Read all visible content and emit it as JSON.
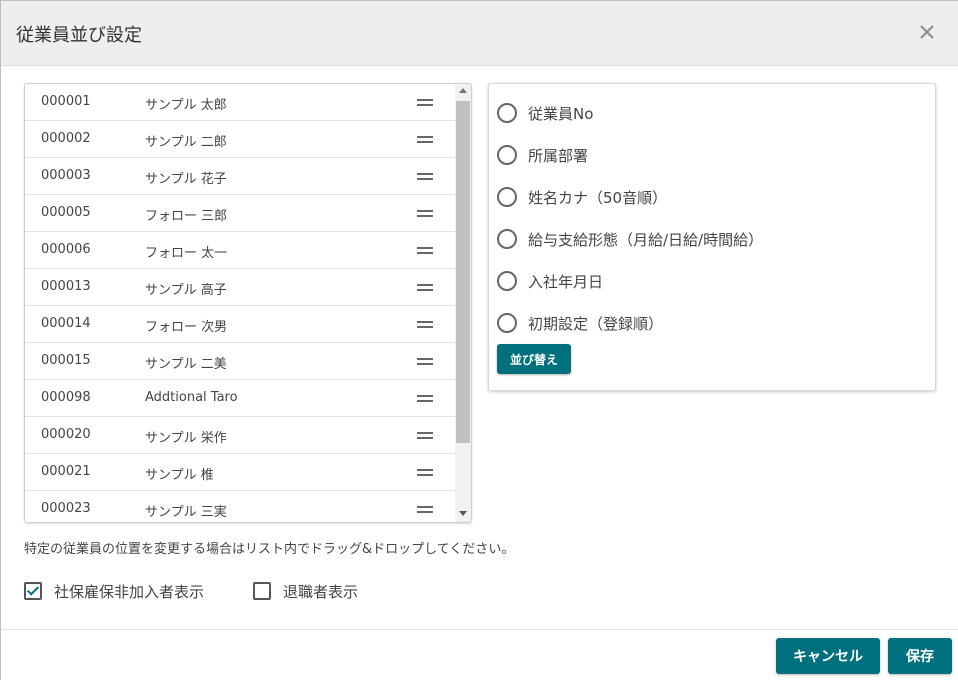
{
  "dialog": {
    "title": "従業員並び設定",
    "close_icon": "close-icon"
  },
  "employees": [
    {
      "id": "000001",
      "name": "サンプル 太郎"
    },
    {
      "id": "000002",
      "name": "サンプル 二郎"
    },
    {
      "id": "000003",
      "name": "サンプル 花子"
    },
    {
      "id": "000005",
      "name": "フォロー 三郎"
    },
    {
      "id": "000006",
      "name": "フォロー 太一"
    },
    {
      "id": "000013",
      "name": "サンプル 高子"
    },
    {
      "id": "000014",
      "name": "フォロー 次男"
    },
    {
      "id": "000015",
      "name": "サンプル 二美"
    },
    {
      "id": "000098",
      "name": "Addtional Taro"
    },
    {
      "id": "000020",
      "name": "サンプル 栄作"
    },
    {
      "id": "000021",
      "name": "サンプル 椎"
    },
    {
      "id": "000023",
      "name": "サンプル 三実"
    }
  ],
  "sort_options": [
    {
      "label": "従業員No",
      "selected": false
    },
    {
      "label": "所属部署",
      "selected": false
    },
    {
      "label": "姓名カナ（50音順）",
      "selected": false
    },
    {
      "label": "給与支給形態（月給/日給/時間給）",
      "selected": false
    },
    {
      "label": "入社年月日",
      "selected": false
    },
    {
      "label": "初期設定（登録順）",
      "selected": false
    }
  ],
  "sort_button": "並び替え",
  "hint": "特定の従業員の位置を変更する場合はリスト内でドラッグ&ドロップしてください。",
  "checkboxes": {
    "social_insurance": {
      "label": "社保雇保非加入者表示",
      "checked": true
    },
    "retired": {
      "label": "退職者表示",
      "checked": false
    }
  },
  "footer": {
    "cancel": "キャンセル",
    "save": "保存"
  },
  "colors": {
    "accent": "#00707f",
    "header_bg": "#eeeeee"
  }
}
